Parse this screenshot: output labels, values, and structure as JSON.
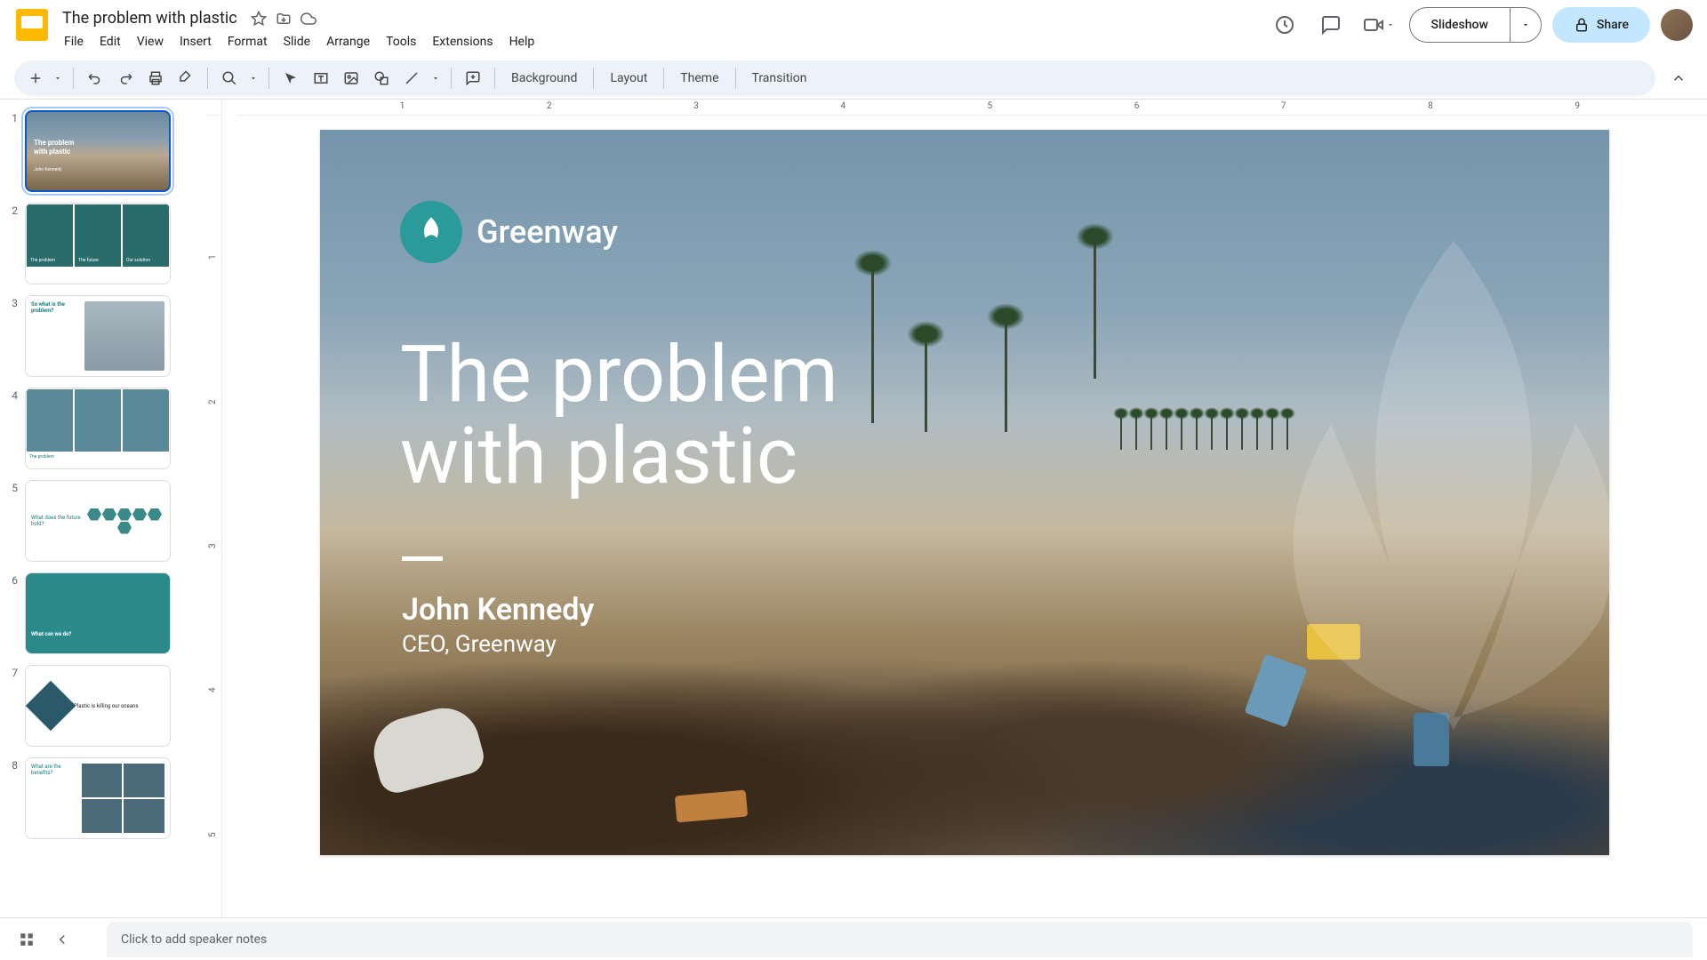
{
  "doc": {
    "title": "The problem with plastic"
  },
  "menu": {
    "file": "File",
    "edit": "Edit",
    "view": "View",
    "insert": "Insert",
    "format": "Format",
    "slide": "Slide",
    "arrange": "Arrange",
    "tools": "Tools",
    "extensions": "Extensions",
    "help": "Help"
  },
  "header": {
    "slideshow": "Slideshow",
    "share": "Share"
  },
  "toolbar": {
    "background": "Background",
    "layout": "Layout",
    "theme": "Theme",
    "transition": "Transition"
  },
  "ruler_h": [
    "1",
    "2",
    "3",
    "4",
    "5",
    "6",
    "7",
    "8",
    "9"
  ],
  "ruler_v": [
    "1",
    "2",
    "3",
    "4",
    "5"
  ],
  "thumbs": [
    {
      "num": "1",
      "title1": "The problem",
      "title2": "with plastic",
      "sub": "John Kennedy"
    },
    {
      "num": "2",
      "c1": "The problem",
      "c2": "The future",
      "c3": "Our solution"
    },
    {
      "num": "3",
      "title": "So what is the problem?"
    },
    {
      "num": "4",
      "label": "The problem"
    },
    {
      "num": "5",
      "title": "What does the future hold?"
    },
    {
      "num": "6",
      "title": "What can we do?"
    },
    {
      "num": "7",
      "title": "Plastic is killing our oceans"
    },
    {
      "num": "8",
      "title": "What are the benefits?"
    }
  ],
  "slide": {
    "brand": "Greenway",
    "title_l1": "The problem",
    "title_l2": "with plastic",
    "author": "John Kennedy",
    "subtitle": "CEO, Greenway"
  },
  "notes": {
    "placeholder": "Click to add speaker notes"
  }
}
